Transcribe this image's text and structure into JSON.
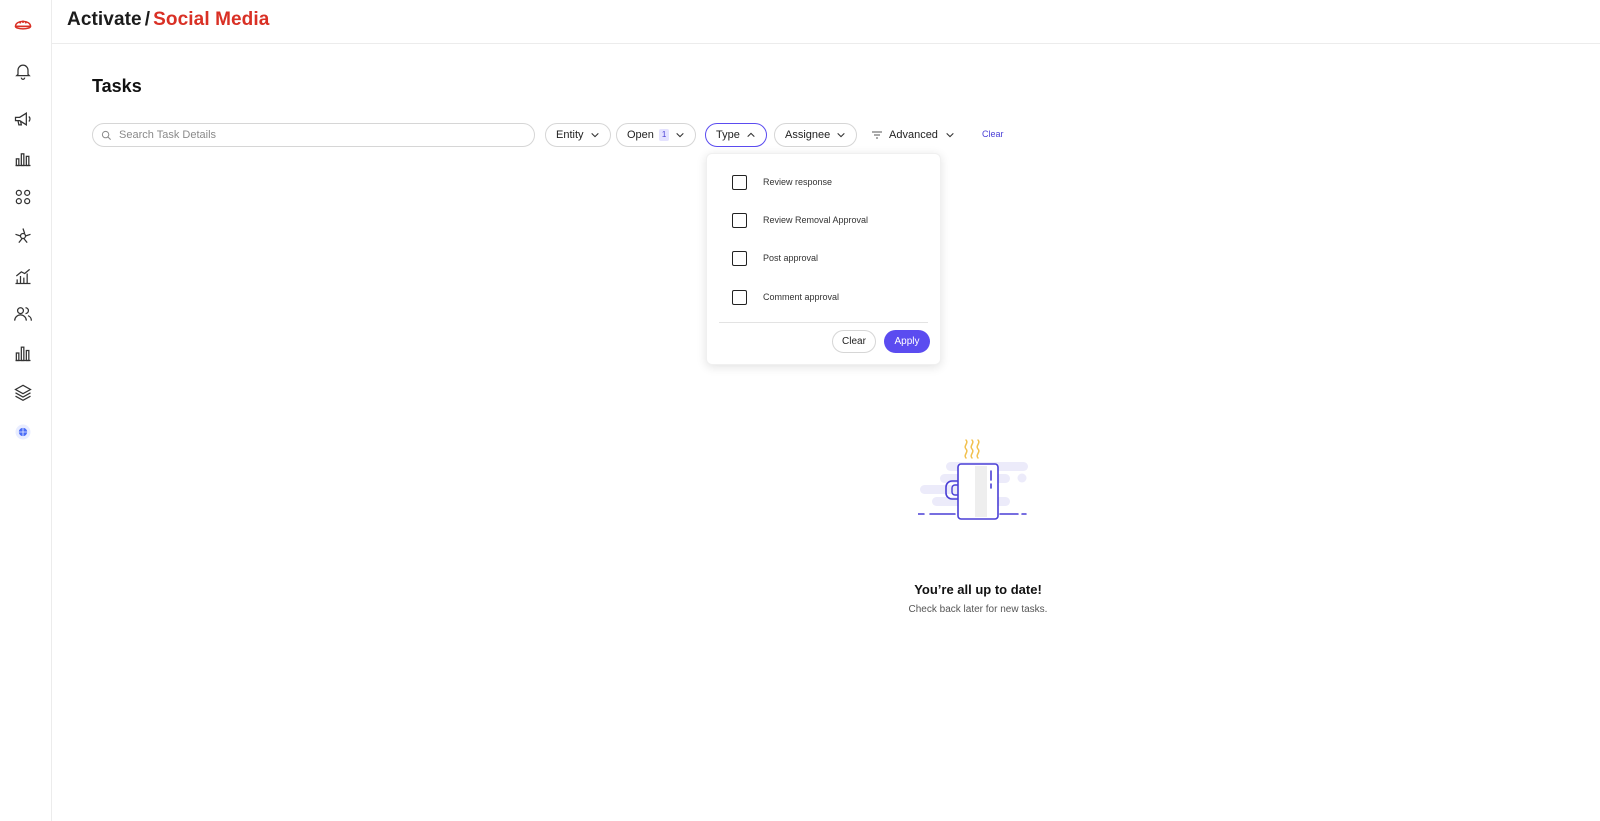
{
  "header": {
    "breadcrumb_root": "Activate",
    "breadcrumb_separator": "/",
    "breadcrumb_current": "Social Media"
  },
  "sidebar": {
    "icons": [
      "logo-icon",
      "bell-icon",
      "megaphone-icon",
      "bar-chart-icon",
      "apps-grid-icon",
      "integrations-icon",
      "growth-chart-icon",
      "users-icon",
      "reports-icon",
      "layers-icon",
      "globe-icon"
    ]
  },
  "page": {
    "title": "Tasks"
  },
  "filters": {
    "search_placeholder": "Search Task Details",
    "entity_label": "Entity",
    "open_label": "Open",
    "open_count": "1",
    "type_label": "Type",
    "assignee_label": "Assignee",
    "advanced_label": "Advanced",
    "clear_label": "Clear"
  },
  "type_dropdown": {
    "options": [
      {
        "label": "Review response",
        "checked": false
      },
      {
        "label": "Review Removal Approval",
        "checked": false
      },
      {
        "label": "Post approval",
        "checked": false
      },
      {
        "label": "Comment approval",
        "checked": false
      }
    ],
    "clear_label": "Clear",
    "apply_label": "Apply"
  },
  "empty_state": {
    "title": "You’re all up to date!",
    "subtitle": "Check back later for new tasks."
  },
  "colors": {
    "brand_red": "#d93025",
    "accent_purple": "#5b4cf0",
    "steam_yellow": "#f2c14e"
  }
}
